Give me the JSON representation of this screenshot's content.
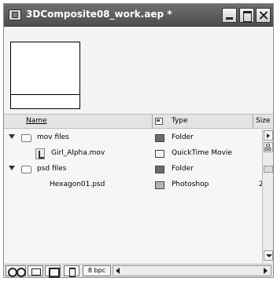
{
  "window": {
    "title": "3DComposite08_work.aep *"
  },
  "columns": {
    "name": "Name",
    "type": "Type",
    "size": "Size"
  },
  "items": [
    {
      "name": "mov files",
      "type": "Folder",
      "kind": "folder",
      "expanded": true,
      "label_color": "#6a6a6a",
      "size": ""
    },
    {
      "name": "Girl_Alpha.mov",
      "type": "QuickTime Movie",
      "kind": "footage",
      "label_color": "#f4f4f4",
      "size": ""
    },
    {
      "name": "psd files",
      "type": "Folder",
      "kind": "folder",
      "expanded": true,
      "label_color": "#6a6a6a",
      "size": ""
    },
    {
      "name": "Hexagon01.psd",
      "type": "Photoshop",
      "kind": "file",
      "label_color": "#b4b4b4",
      "size": "2"
    }
  ],
  "bottom_bar": {
    "bit_depth": "8 bpc"
  },
  "icons": {
    "title": "ae-project-icon",
    "find": "binoculars-icon",
    "new_folder": "folder-icon",
    "new_comp": "composition-icon",
    "delete": "trash-icon",
    "flowchart": "flowchart-icon"
  }
}
